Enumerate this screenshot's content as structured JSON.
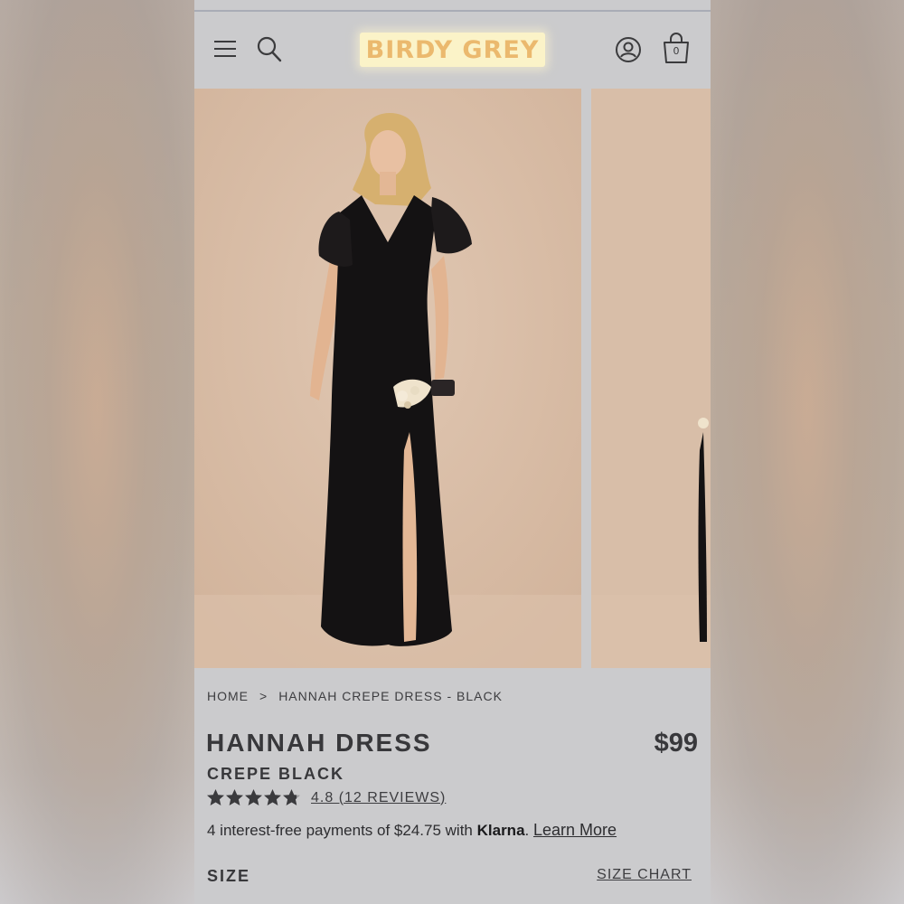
{
  "header": {
    "logo_text": "BIRDY GREY",
    "cart_count": "0",
    "icons": {
      "menu": "hamburger-menu-icon",
      "search": "search-icon",
      "account": "account-icon",
      "cart": "shopping-bag-icon"
    }
  },
  "gallery": {
    "slides": [
      {
        "description": "model-in-black-dress"
      },
      {
        "description": "model-in-black-dress-next"
      }
    ]
  },
  "breadcrumb": {
    "home": "HOME",
    "separator": ">",
    "current": "HANNAH CREPE DRESS - BLACK"
  },
  "product": {
    "title": "HANNAH DRESS",
    "variant": "CREPE BLACK",
    "price": "$99",
    "rating_value": 4.8,
    "rating_max": 5,
    "reviews_text": "4.8 (12 REVIEWS)",
    "installments_text": "4 interest-free payments of $24.75 with ",
    "klarna_label": "Klarna",
    "installments_suffix": ". ",
    "learn_more": "Learn More",
    "size_label": "SIZE",
    "size_chart": "SIZE CHART"
  },
  "colors": {
    "background_panel": "#cbcbcd",
    "logo_bg": "#fbf3c8",
    "logo_text": "#ebb96e",
    "text_dark": "#38383b",
    "photo_bg": "#d7bca5"
  }
}
